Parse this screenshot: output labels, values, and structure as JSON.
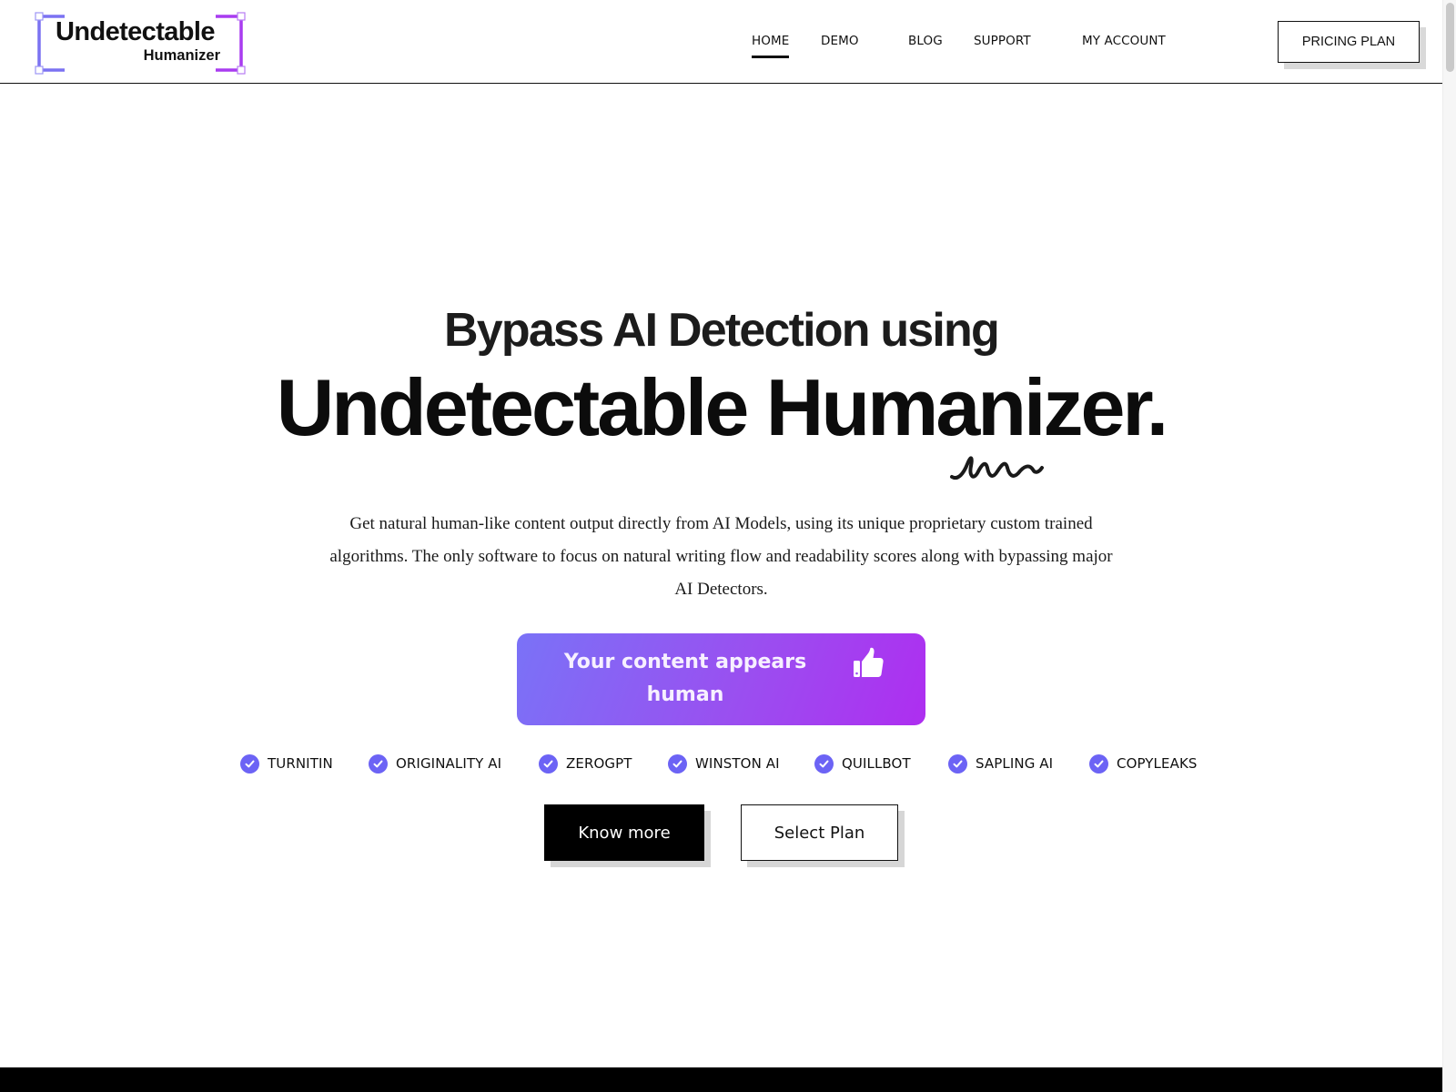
{
  "header": {
    "logo": {
      "main": "Undetectable",
      "sub": "Humanizer",
      "bracket_color_left": "#7b72f2",
      "bracket_color_right": "#a93cf0"
    },
    "nav": [
      {
        "label": "HOME",
        "active": true
      },
      {
        "label": "DEMO",
        "active": false
      },
      {
        "label": "BLOG",
        "active": false
      },
      {
        "label": "SUPPORT",
        "active": false
      },
      {
        "label": "MY ACCOUNT",
        "active": false
      }
    ],
    "cta_label": "PRICING PLAN"
  },
  "hero": {
    "subtitle": "Bypass AI Detection using",
    "title": "Undetectable Humanizer.",
    "description": "Get natural human-like content output directly from AI Models, using its unique proprietary custom trained algorithms. The only software to focus on natural writing flow and readability scores along with bypassing major AI Detectors.",
    "result_card": {
      "text": "Your content appears human",
      "icon": "thumbs-up-icon",
      "gradient_start": "#7a72f7",
      "gradient_end": "#ae2ef0"
    },
    "detectors": [
      {
        "label": "TURNITIN",
        "icon": "check-circle-icon"
      },
      {
        "label": "ORIGINALITY AI",
        "icon": "check-circle-icon"
      },
      {
        "label": "ZEROGPT",
        "icon": "check-circle-icon"
      },
      {
        "label": "WINSTON AI",
        "icon": "check-circle-icon"
      },
      {
        "label": "QUILLBOT",
        "icon": "check-circle-icon"
      },
      {
        "label": "SAPLING AI",
        "icon": "check-circle-icon"
      },
      {
        "label": "COPYLEAKS",
        "icon": "check-circle-icon"
      }
    ],
    "check_color": "#6c63f5",
    "buttons": {
      "know_more": "Know more",
      "select_plan": "Select Plan"
    }
  }
}
